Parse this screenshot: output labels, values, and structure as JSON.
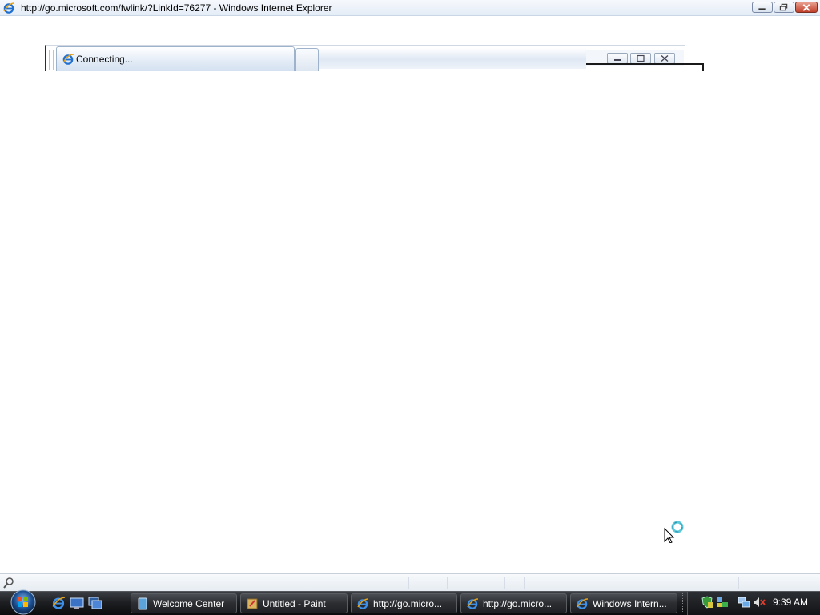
{
  "window": {
    "title": "http://go.microsoft.com/fwlink/?LinkId=76277 - Windows Internet Explorer",
    "icon": "ie-icon",
    "buttons": [
      "minimize",
      "restore",
      "close"
    ]
  },
  "tabs": {
    "active_label": "Connecting...",
    "active_icon": "ie-icon",
    "new_tab_icon": "new-tab-icon"
  },
  "cursor": {
    "state": "busy"
  },
  "statusbar": {
    "icon": "search-icon"
  },
  "taskbar": {
    "start_icon": "windows-orb-icon",
    "quick_launch": [
      "ie-icon",
      "show-desktop-icon",
      "switch-windows-icon"
    ],
    "tasks": [
      {
        "label": "Welcome Center",
        "icon": "welcome-center-icon"
      },
      {
        "label": "Untitled - Paint",
        "icon": "paint-icon"
      },
      {
        "label": "http://go.micro...",
        "icon": "ie-icon"
      },
      {
        "label": "http://go.micro...",
        "icon": "ie-icon"
      },
      {
        "label": "Windows Intern...",
        "icon": "ie-icon"
      }
    ],
    "tray": {
      "icons": [
        "security-shield-icon",
        "network-adapter-icon",
        "network-icon",
        "volume-muted-icon"
      ],
      "clock": "9:39 AM"
    }
  },
  "colors": {
    "titlebar": "#e4ecf6",
    "taskbar": "#1d1f22",
    "close_button": "#c0402a"
  }
}
